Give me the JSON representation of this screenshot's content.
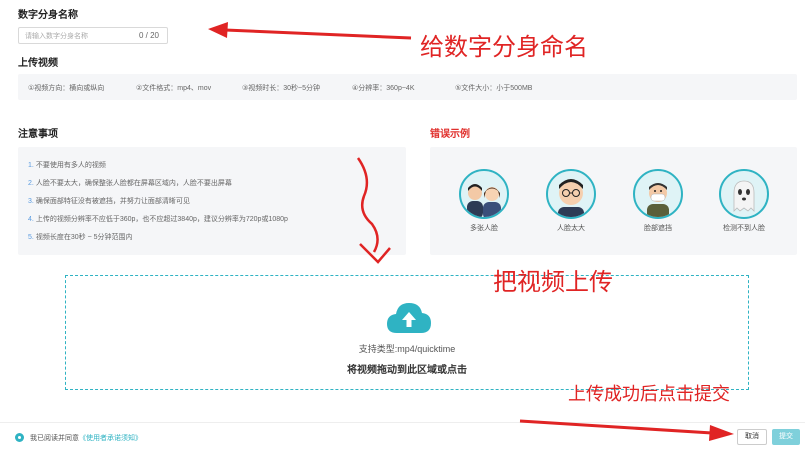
{
  "form": {
    "name_title": "数字分身名称",
    "name_placeholder": "请输入数字分身名称",
    "name_counter": "0 / 20",
    "upload_title": "上传视频",
    "specs": [
      "①视频方向：横向或纵向",
      "②文件格式：mp4、mov",
      "③视频时长：30秒~5分钟",
      "④分辨率：360p~4K",
      "⑤文件大小：小于500MB"
    ]
  },
  "notice": {
    "title": "注意事项",
    "items": [
      {
        "num": "1.",
        "text": "不要使用有多人的视频"
      },
      {
        "num": "2.",
        "text": "人脸不要太大，确保整张人脸都在屏幕区域内，人脸不要出屏幕"
      },
      {
        "num": "3.",
        "text": "确保面部特征没有被遮挡，并努力让面部清晰可见"
      },
      {
        "num": "4.",
        "text": "上传的视频分辨率不应低于360p，也不应超过3840p，建议分辨率为720p或1080p"
      },
      {
        "num": "5.",
        "text": "视频长度在30秒 ~ 5分钟范围内"
      }
    ]
  },
  "errors": {
    "title": "错误示例",
    "examples": [
      {
        "label": "多张人脸",
        "icon": "multiple-faces-icon"
      },
      {
        "label": "人脸太大",
        "icon": "face-too-large-icon"
      },
      {
        "label": "脸部遮挡",
        "icon": "face-covered-icon"
      },
      {
        "label": "检测不到人脸",
        "icon": "no-face-icon"
      }
    ]
  },
  "upload": {
    "icon": "cloud-upload-icon",
    "supported": "支持类型:mp4/quicktime",
    "action": "将视频拖动到此区域或点击"
  },
  "footer": {
    "agree_text": "我已阅读并同意",
    "agree_link": "《使用者承诺须知》",
    "cancel_label": "取消",
    "submit_label": "提交"
  },
  "annotations": {
    "name_hint": "给数字分身命名",
    "upload_hint": "把视频上传",
    "submit_hint": "上传成功后点击提交"
  },
  "colors": {
    "accent": "#2fb3c3",
    "error": "#e0312e",
    "annotation": "#e02424"
  }
}
